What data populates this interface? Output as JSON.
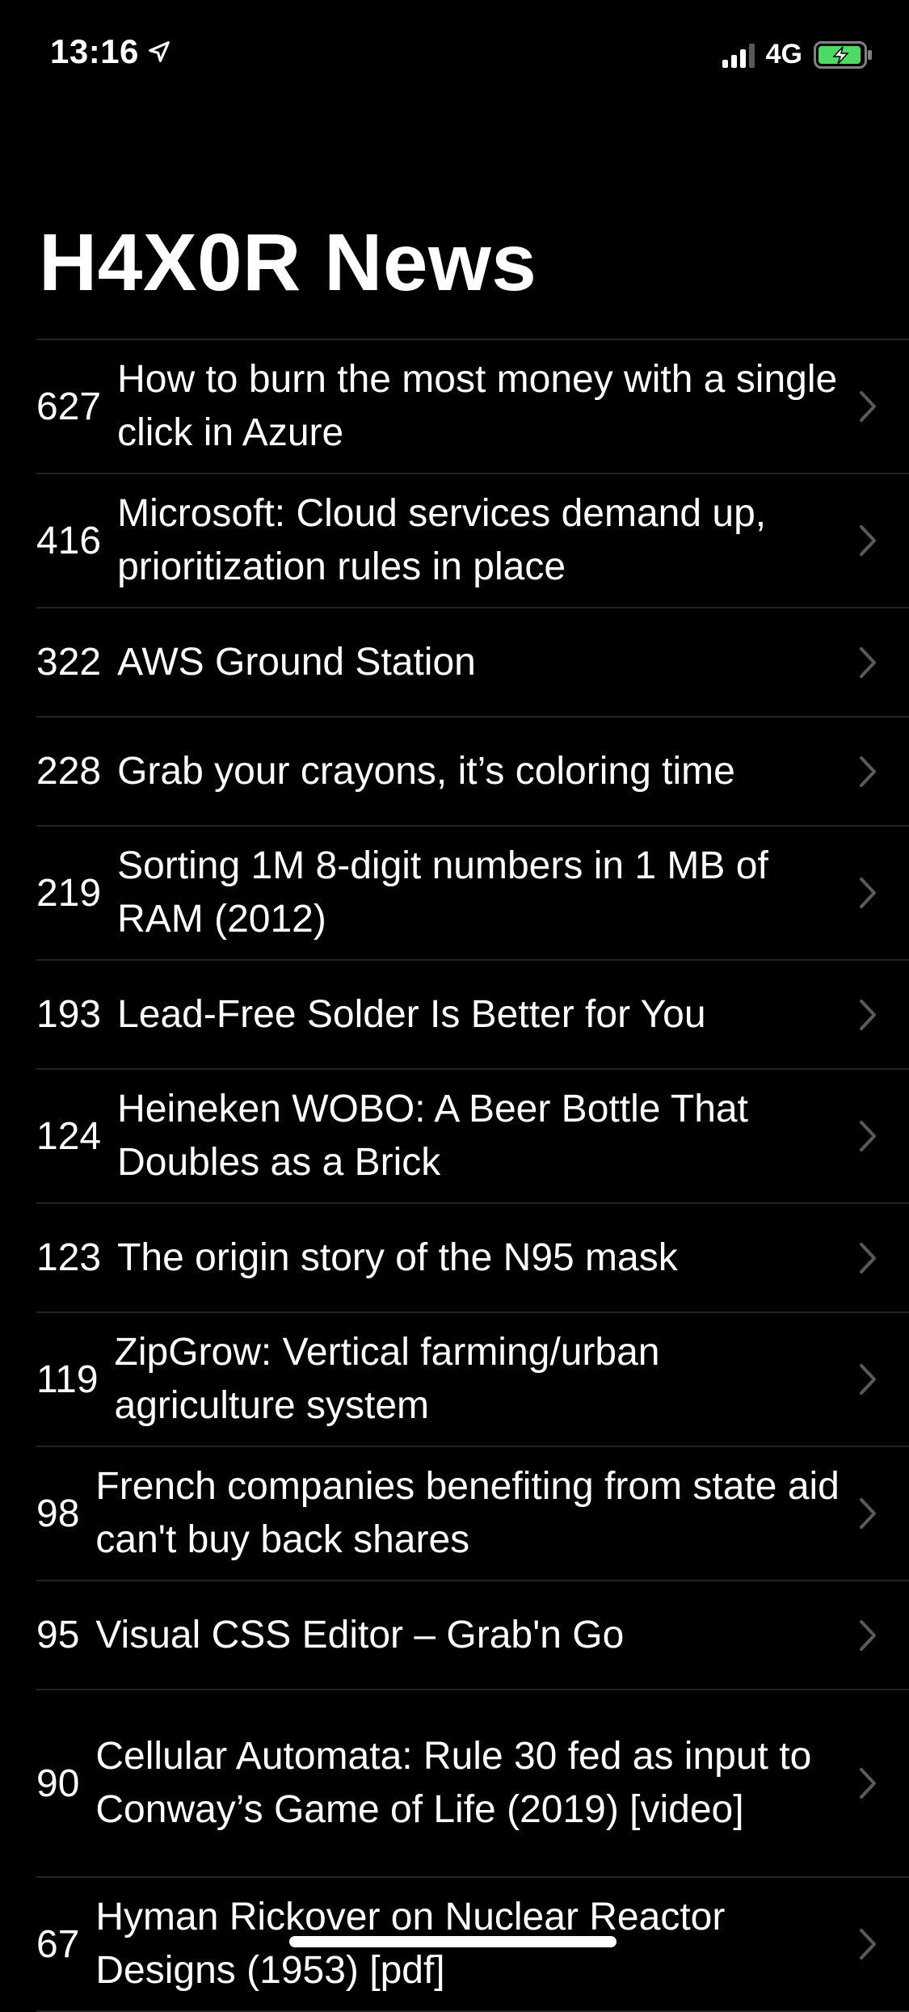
{
  "status_bar": {
    "time": "13:16",
    "network": "4G",
    "icons": [
      "location-arrow-icon",
      "signal-bars-icon",
      "battery-charging-icon"
    ]
  },
  "app": {
    "title": "H4X0R News"
  },
  "colors": {
    "background": "#000000",
    "text": "#ffffff",
    "separator": "#222222",
    "chevron": "#5a5a5e",
    "battery_fill": "#4cd964"
  },
  "stories": [
    {
      "score": "627",
      "title": "How to burn the most money with a single click in Azure"
    },
    {
      "score": "416",
      "title": "Microsoft: Cloud services demand up, prioritization rules in place"
    },
    {
      "score": "322",
      "title": "AWS Ground Station"
    },
    {
      "score": "228",
      "title": "Grab your crayons, it’s coloring time"
    },
    {
      "score": "219",
      "title": "Sorting 1M 8-digit numbers in 1 MB of RAM (2012)"
    },
    {
      "score": "193",
      "title": "Lead-Free Solder Is Better for You"
    },
    {
      "score": "124",
      "title": "Heineken WOBO: A Beer Bottle That Doubles as a Brick"
    },
    {
      "score": "123",
      "title": "The origin story of the N95 mask"
    },
    {
      "score": "119",
      "title": "ZipGrow: Vertical farming/urban agriculture system"
    },
    {
      "score": "98",
      "title": "French companies benefiting from state aid can't buy back shares"
    },
    {
      "score": "95",
      "title": "Visual CSS Editor – Grab'n Go"
    },
    {
      "score": "90",
      "title": "Cellular Automata: Rule 30 fed as input to Conway’s Game of Life (2019) [video]"
    },
    {
      "score": "67",
      "title": "Hyman Rickover on Nuclear Reactor Designs (1953) [pdf]"
    }
  ]
}
